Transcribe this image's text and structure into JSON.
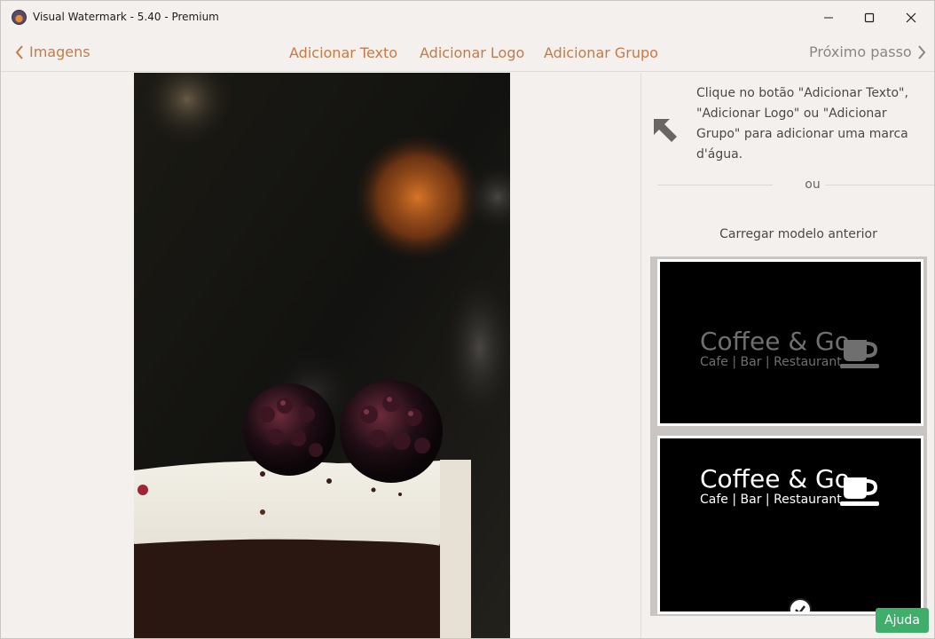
{
  "window": {
    "title": "Visual Watermark - 5.40 - Premium",
    "controls": {
      "minimize_icon": "minimize-icon",
      "maximize_icon": "maximize-icon",
      "close_icon": "close-icon"
    }
  },
  "toolbar": {
    "back_label": "Imagens",
    "add_text_label": "Adicionar Texto",
    "add_logo_label": "Adicionar Logo",
    "add_group_label": "Adicionar Grupo",
    "next_label": "Próximo passo",
    "accent_color": "#c97a44",
    "disabled_color": "#8a8684"
  },
  "canvas": {
    "photo_description_icon": "cake-photo"
  },
  "right_panel": {
    "hint_text": "Clique no botão \"Adicionar Texto\", \"Adicionar Logo\" ou \"Adicionar Grupo\" para adicionar uma marca d'água.",
    "or_label": "ou",
    "load_template_label": "Carregar modelo anterior",
    "templates": [
      {
        "brand": "Coffee & Go",
        "subtitle": "Cafe | Bar | Restaurant",
        "style": "gray"
      },
      {
        "brand": "Coffee & Go",
        "subtitle": "Cafe | Bar | Restaurant",
        "style": "white",
        "selected": true
      }
    ]
  },
  "help_button_label": "Ajuda",
  "help_button_color": "#3fae6a"
}
